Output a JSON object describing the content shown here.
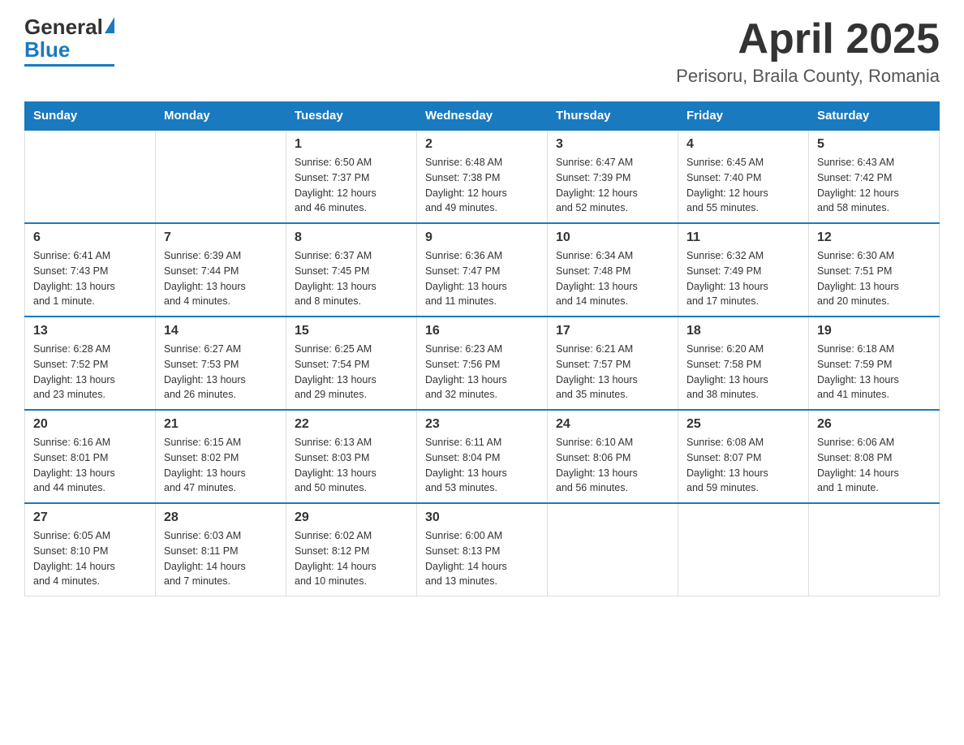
{
  "logo": {
    "general": "General",
    "blue": "Blue"
  },
  "title": "April 2025",
  "subtitle": "Perisoru, Braila County, Romania",
  "days": [
    "Sunday",
    "Monday",
    "Tuesday",
    "Wednesday",
    "Thursday",
    "Friday",
    "Saturday"
  ],
  "weeks": [
    [
      {
        "num": "",
        "info": ""
      },
      {
        "num": "",
        "info": ""
      },
      {
        "num": "1",
        "info": "Sunrise: 6:50 AM\nSunset: 7:37 PM\nDaylight: 12 hours\nand 46 minutes."
      },
      {
        "num": "2",
        "info": "Sunrise: 6:48 AM\nSunset: 7:38 PM\nDaylight: 12 hours\nand 49 minutes."
      },
      {
        "num": "3",
        "info": "Sunrise: 6:47 AM\nSunset: 7:39 PM\nDaylight: 12 hours\nand 52 minutes."
      },
      {
        "num": "4",
        "info": "Sunrise: 6:45 AM\nSunset: 7:40 PM\nDaylight: 12 hours\nand 55 minutes."
      },
      {
        "num": "5",
        "info": "Sunrise: 6:43 AM\nSunset: 7:42 PM\nDaylight: 12 hours\nand 58 minutes."
      }
    ],
    [
      {
        "num": "6",
        "info": "Sunrise: 6:41 AM\nSunset: 7:43 PM\nDaylight: 13 hours\nand 1 minute."
      },
      {
        "num": "7",
        "info": "Sunrise: 6:39 AM\nSunset: 7:44 PM\nDaylight: 13 hours\nand 4 minutes."
      },
      {
        "num": "8",
        "info": "Sunrise: 6:37 AM\nSunset: 7:45 PM\nDaylight: 13 hours\nand 8 minutes."
      },
      {
        "num": "9",
        "info": "Sunrise: 6:36 AM\nSunset: 7:47 PM\nDaylight: 13 hours\nand 11 minutes."
      },
      {
        "num": "10",
        "info": "Sunrise: 6:34 AM\nSunset: 7:48 PM\nDaylight: 13 hours\nand 14 minutes."
      },
      {
        "num": "11",
        "info": "Sunrise: 6:32 AM\nSunset: 7:49 PM\nDaylight: 13 hours\nand 17 minutes."
      },
      {
        "num": "12",
        "info": "Sunrise: 6:30 AM\nSunset: 7:51 PM\nDaylight: 13 hours\nand 20 minutes."
      }
    ],
    [
      {
        "num": "13",
        "info": "Sunrise: 6:28 AM\nSunset: 7:52 PM\nDaylight: 13 hours\nand 23 minutes."
      },
      {
        "num": "14",
        "info": "Sunrise: 6:27 AM\nSunset: 7:53 PM\nDaylight: 13 hours\nand 26 minutes."
      },
      {
        "num": "15",
        "info": "Sunrise: 6:25 AM\nSunset: 7:54 PM\nDaylight: 13 hours\nand 29 minutes."
      },
      {
        "num": "16",
        "info": "Sunrise: 6:23 AM\nSunset: 7:56 PM\nDaylight: 13 hours\nand 32 minutes."
      },
      {
        "num": "17",
        "info": "Sunrise: 6:21 AM\nSunset: 7:57 PM\nDaylight: 13 hours\nand 35 minutes."
      },
      {
        "num": "18",
        "info": "Sunrise: 6:20 AM\nSunset: 7:58 PM\nDaylight: 13 hours\nand 38 minutes."
      },
      {
        "num": "19",
        "info": "Sunrise: 6:18 AM\nSunset: 7:59 PM\nDaylight: 13 hours\nand 41 minutes."
      }
    ],
    [
      {
        "num": "20",
        "info": "Sunrise: 6:16 AM\nSunset: 8:01 PM\nDaylight: 13 hours\nand 44 minutes."
      },
      {
        "num": "21",
        "info": "Sunrise: 6:15 AM\nSunset: 8:02 PM\nDaylight: 13 hours\nand 47 minutes."
      },
      {
        "num": "22",
        "info": "Sunrise: 6:13 AM\nSunset: 8:03 PM\nDaylight: 13 hours\nand 50 minutes."
      },
      {
        "num": "23",
        "info": "Sunrise: 6:11 AM\nSunset: 8:04 PM\nDaylight: 13 hours\nand 53 minutes."
      },
      {
        "num": "24",
        "info": "Sunrise: 6:10 AM\nSunset: 8:06 PM\nDaylight: 13 hours\nand 56 minutes."
      },
      {
        "num": "25",
        "info": "Sunrise: 6:08 AM\nSunset: 8:07 PM\nDaylight: 13 hours\nand 59 minutes."
      },
      {
        "num": "26",
        "info": "Sunrise: 6:06 AM\nSunset: 8:08 PM\nDaylight: 14 hours\nand 1 minute."
      }
    ],
    [
      {
        "num": "27",
        "info": "Sunrise: 6:05 AM\nSunset: 8:10 PM\nDaylight: 14 hours\nand 4 minutes."
      },
      {
        "num": "28",
        "info": "Sunrise: 6:03 AM\nSunset: 8:11 PM\nDaylight: 14 hours\nand 7 minutes."
      },
      {
        "num": "29",
        "info": "Sunrise: 6:02 AM\nSunset: 8:12 PM\nDaylight: 14 hours\nand 10 minutes."
      },
      {
        "num": "30",
        "info": "Sunrise: 6:00 AM\nSunset: 8:13 PM\nDaylight: 14 hours\nand 13 minutes."
      },
      {
        "num": "",
        "info": ""
      },
      {
        "num": "",
        "info": ""
      },
      {
        "num": "",
        "info": ""
      }
    ]
  ]
}
